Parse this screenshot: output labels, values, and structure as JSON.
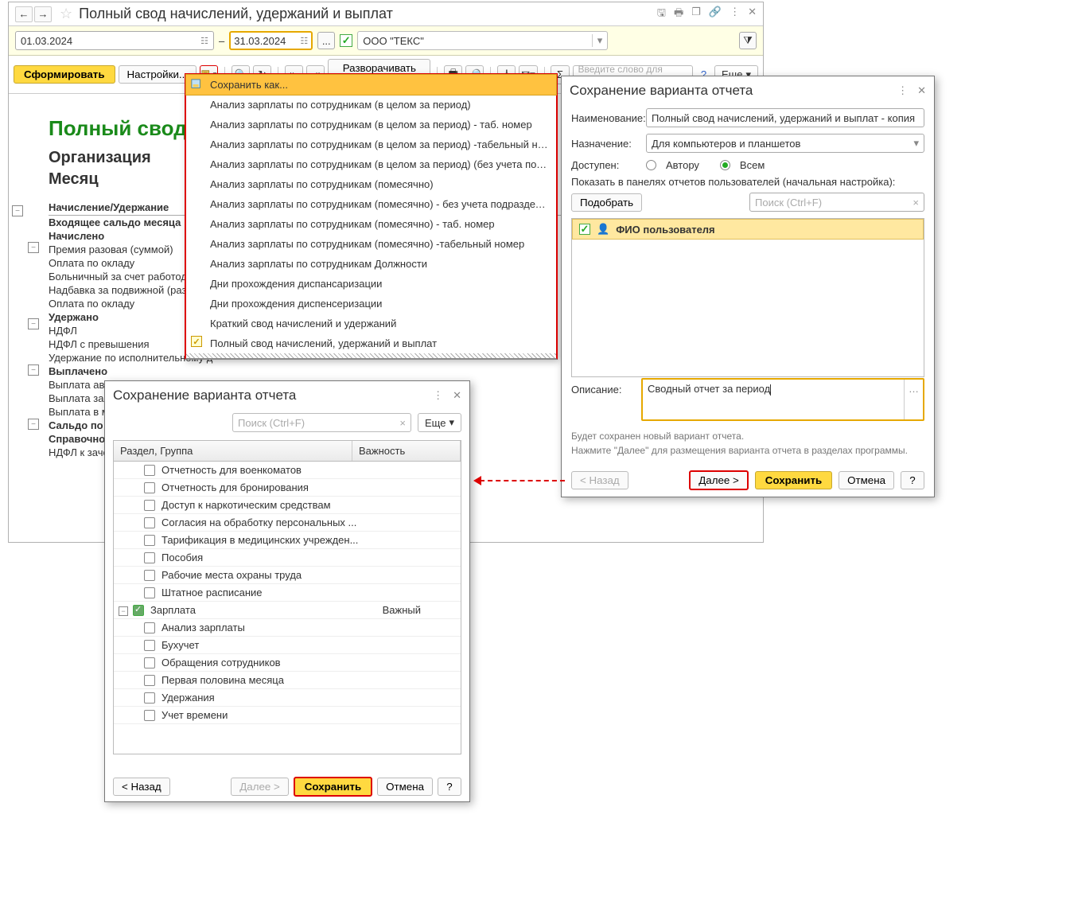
{
  "main": {
    "title": "Полный свод начислений, удержаний и выплат",
    "date_from": "01.03.2024",
    "date_sep": "–",
    "date_to": "31.03.2024",
    "org_name": "ООО \"ТЕКС\"",
    "ellipsis": "...",
    "form_button": "Сформировать",
    "settings_button": "Настройки...",
    "expand_menu": "Разворачивать до",
    "search_placeholder": "Введите слово для фильтра (...",
    "help": "?",
    "more": "Еще"
  },
  "report": {
    "title_visible": "Полный свод",
    "org_label": "Организация",
    "month_label": "Месяц",
    "section": "Начисление/Удержание",
    "rows": [
      {
        "t": "Входящее сальдо месяца",
        "b": true
      },
      {
        "t": "Начислено",
        "b": true
      },
      {
        "t": "Премия разовая (суммой)",
        "b": false
      },
      {
        "t": "Оплата по окладу",
        "b": false
      },
      {
        "t": "Больничный за счет работодателя",
        "b": false
      },
      {
        "t": "Надбавка за подвижной (разъезд...",
        "b": false
      },
      {
        "t": "Оплата по окладу",
        "b": false
      },
      {
        "t": "Удержано",
        "b": true
      },
      {
        "t": "НДФЛ",
        "b": false
      },
      {
        "t": "НДФЛ с превышения",
        "b": false
      },
      {
        "t": "Удержание по исполнительному д",
        "b": false
      },
      {
        "t": "Выплачено",
        "b": true
      },
      {
        "t": "Выплата аванса",
        "b": false
      },
      {
        "t": "Выплата зарплаты",
        "b": false
      },
      {
        "t": "Выплата в м",
        "b": false
      },
      {
        "t": "Сальдо по и",
        "b": true
      },
      {
        "t": "Справочно",
        "b": true
      },
      {
        "t": "НДФЛ к заче",
        "b": false
      }
    ]
  },
  "dropdown": {
    "top": "Сохранить как...",
    "items": [
      "Анализ зарплаты по сотрудникам (в целом за период)",
      "Анализ зарплаты по сотрудникам (в целом за период) - таб. номер",
      "Анализ зарплаты по сотрудникам (в целом за период) -табельный номер",
      "Анализ зарплаты по сотрудникам (в целом за период) (без учета подразделений)",
      "Анализ зарплаты по сотрудникам (помесячно)",
      "Анализ зарплаты по сотрудникам (помесячно) - без учета подразделений",
      "Анализ зарплаты по сотрудникам (помесячно) - таб. номер",
      "Анализ зарплаты по сотрудникам (помесячно) -табельный номер",
      "Анализ зарплаты по сотрудникам Должности",
      "Дни прохождения диспансаризации",
      "Дни прохождения диспенсеризации",
      "Краткий свод начислений и удержаний",
      "Полный свод начислений, удержаний и выплат"
    ]
  },
  "dlg2": {
    "title": "Сохранение варианта отчета",
    "search_ph": "Поиск (Ctrl+F)",
    "more": "Еще",
    "col1": "Раздел, Группа",
    "col2": "Важность",
    "rows": [
      {
        "t": "Отчетность для военкоматов",
        "grp": false
      },
      {
        "t": "Отчетность для бронирования",
        "grp": false
      },
      {
        "t": "Доступ к наркотическим средствам",
        "grp": false
      },
      {
        "t": "Согласия на обработку персональных ...",
        "grp": false
      },
      {
        "t": "Тарификация в медицинских учрежден...",
        "grp": false
      },
      {
        "t": "Пособия",
        "grp": false
      },
      {
        "t": "Рабочие места охраны труда",
        "grp": false
      },
      {
        "t": "Штатное расписание",
        "grp": false
      },
      {
        "t": "Зарплата",
        "grp": true,
        "checked": true,
        "imp": "Важный"
      },
      {
        "t": "Анализ зарплаты",
        "grp": false
      },
      {
        "t": "Бухучет",
        "grp": false
      },
      {
        "t": "Обращения сотрудников",
        "grp": false
      },
      {
        "t": "Первая половина месяца",
        "grp": false
      },
      {
        "t": "Удержания",
        "grp": false
      },
      {
        "t": "Учет времени",
        "grp": false
      }
    ],
    "back": "<  Назад",
    "next": "Далее  >",
    "save": "Сохранить",
    "cancel": "Отмена",
    "help": "?"
  },
  "dlg1": {
    "title": "Сохранение варианта отчета",
    "name_label": "Наименование:",
    "name_value": "Полный свод начислений, удержаний и выплат - копия",
    "dest_label": "Назначение:",
    "dest_value": "Для компьютеров и планшетов",
    "avail_label": "Доступен:",
    "radio_author": "Автору",
    "radio_all": "Всем",
    "panel_hint": "Показать в панелях отчетов пользователей (начальная настройка):",
    "pick": "Подобрать",
    "search_ph": "Поиск (Ctrl+F)",
    "user_row": "ФИО пользователя",
    "desc_label": "Описание:",
    "desc_value": "Сводный отчет за период",
    "hint1": "Будет сохранен новый вариант отчета.",
    "hint2": "Нажмите \"Далее\" для размещения варианта отчета в разделах программы.",
    "back": "<  Назад",
    "next": "Далее  >",
    "save": "Сохранить",
    "cancel": "Отмена",
    "help": "?"
  }
}
